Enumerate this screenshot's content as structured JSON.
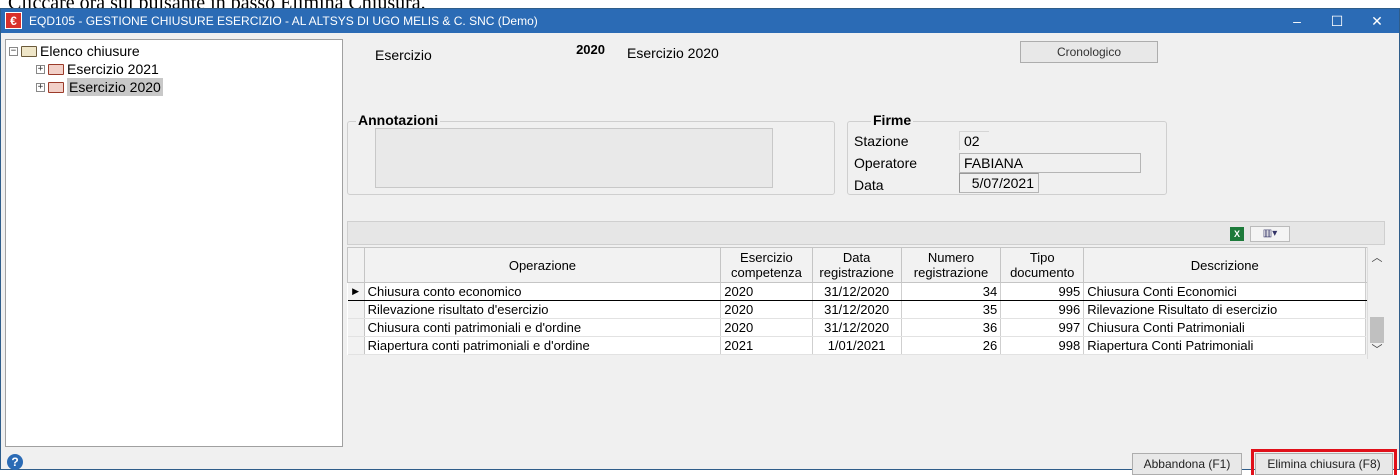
{
  "caption": "Cliccare ora sul pulsante in basso Elimina Chiusura.",
  "window": {
    "icon": "app-logo-icon",
    "title": "EQD105 - GESTIONE CHIUSURE ESERCIZIO - AL ALTSYS DI UGO MELIS & C. SNC  (Demo)",
    "controls": [
      "–",
      "☐",
      "✕"
    ]
  },
  "tree": {
    "root": {
      "label": "Elenco chiusure",
      "toggle": "⊟"
    },
    "children": [
      {
        "label": "Esercizio 2021",
        "toggle": "⊞"
      },
      {
        "label": "Esercizio 2020",
        "toggle": "⊞"
      }
    ]
  },
  "header": {
    "esercizio_label": "Esercizio",
    "esercizio_value": "2020",
    "esercizio_desc": "Esercizio 2020",
    "cronologico_button": "Cronologico"
  },
  "annotazioni": {
    "title": "Annotazioni",
    "value": ""
  },
  "firme": {
    "title": "Firme",
    "stazione_label": "Stazione",
    "stazione_value": "02",
    "operatore_label": "Operatore",
    "operatore_value": "FABIANA",
    "data_label": "Data",
    "data_value": "5/07/2021"
  },
  "grid": {
    "toolbar": {
      "excel_icon": "excel-export-icon",
      "columns_icon": "column-chooser-icon"
    },
    "columns": [
      "Operazione",
      "Esercizio competenza",
      "Data registrazione",
      "Numero registrazione",
      "Tipo documento",
      "Descrizione"
    ],
    "rows": [
      {
        "indicator": "▶",
        "operazione": "Chiusura conto economico",
        "esercizio": "2020",
        "data": "31/12/2020",
        "numero": "34",
        "tipo": "995",
        "descrizione": "Chiusura Conti Economici"
      },
      {
        "indicator": "",
        "operazione": "Rilevazione risultato d'esercizio",
        "esercizio": "2020",
        "data": "31/12/2020",
        "numero": "35",
        "tipo": "996",
        "descrizione": "Rilevazione Risultato di esercizio"
      },
      {
        "indicator": "",
        "operazione": "Chiusura conti patrimoniali e d'ordine",
        "esercizio": "2020",
        "data": "31/12/2020",
        "numero": "36",
        "tipo": "997",
        "descrizione": "Chiusura Conti Patrimoniali"
      },
      {
        "indicator": "",
        "operazione": "Riapertura conti patrimoniali e d'ordine",
        "esercizio": "2021",
        "data": "1/01/2021",
        "numero": "26",
        "tipo": "998",
        "descrizione": "Riapertura Conti Patrimoniali"
      }
    ]
  },
  "footer": {
    "help_icon": "help-icon",
    "abbandona_button": "Abbandona (F1)",
    "elimina_button": "Elimina chiusura (F8)",
    "highlight_color": "#e0101a"
  }
}
